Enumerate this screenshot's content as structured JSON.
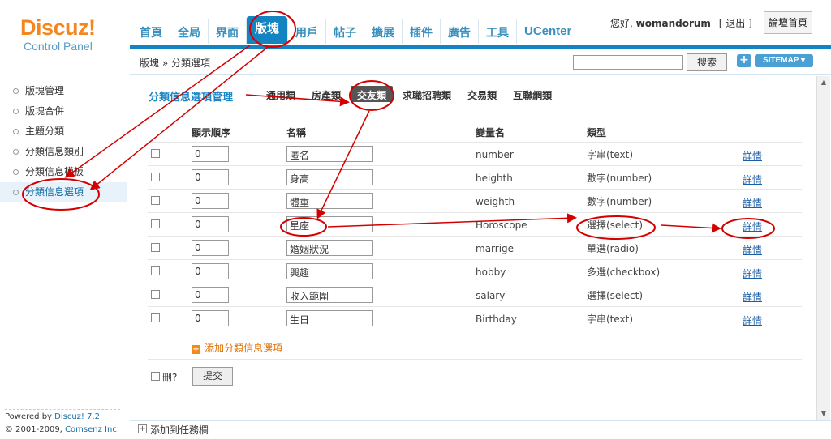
{
  "logo": {
    "brand": "Discuz!",
    "sub": "Control Panel"
  },
  "topnav": {
    "tabs": [
      "首頁",
      "全局",
      "界面",
      "版塊",
      "用戶",
      "帖子",
      "擴展",
      "插件",
      "廣告",
      "工具",
      "UCenter"
    ],
    "active_index": 3
  },
  "userbar": {
    "greeting": "您好,",
    "username": "womandorum",
    "logout": "[ 退出 ]",
    "forum_home": "論壇首頁"
  },
  "breadcrumb": "版塊 » 分類選項",
  "search": {
    "value": "",
    "button": "搜索",
    "plus": "+",
    "sitemap": "SITEMAP ▾"
  },
  "sidebar": {
    "items": [
      "版塊管理",
      "版塊合併",
      "主題分類",
      "分類信息類別",
      "分類信息模板",
      "分類信息選項"
    ],
    "active_index": 5
  },
  "powered": {
    "line1_prefix": "Powered by",
    "line1_link": "Discuz! 7.2",
    "line2_prefix": "© 2001-2009,",
    "line2_link": "Comsenz Inc."
  },
  "main": {
    "title": "分類信息選項管理",
    "subtabs": [
      "通用類",
      "房產類",
      "交友類",
      "求職招聘類",
      "交易類",
      "互聯網類"
    ],
    "active_subtab": 2,
    "columns": {
      "order": "顯示順序",
      "name": "名稱",
      "var": "變量名",
      "type": "類型"
    },
    "rows": [
      {
        "order": "0",
        "name": "匿名",
        "var": "number",
        "type": "字串(text)",
        "detail": "詳情"
      },
      {
        "order": "0",
        "name": "身高",
        "var": "heighth",
        "type": "數字(number)",
        "detail": "詳情"
      },
      {
        "order": "0",
        "name": "體重",
        "var": "weighth",
        "type": "數字(number)",
        "detail": "詳情"
      },
      {
        "order": "0",
        "name": "星座",
        "var": "Horoscope",
        "type": "選擇(select)",
        "detail": "詳情"
      },
      {
        "order": "0",
        "name": "婚姻狀況",
        "var": "marrige",
        "type": "單選(radio)",
        "detail": "詳情"
      },
      {
        "order": "0",
        "name": "興趣",
        "var": "hobby",
        "type": "多選(checkbox)",
        "detail": "詳情"
      },
      {
        "order": "0",
        "name": "收入範圍",
        "var": "salary",
        "type": "選擇(select)",
        "detail": "詳情"
      },
      {
        "order": "0",
        "name": "生日",
        "var": "Birthday",
        "type": "字串(text)",
        "detail": "詳情"
      }
    ],
    "add_label": "添加分類信息選項",
    "delete_label": "刪?",
    "submit": "提交"
  },
  "taskbar": {
    "label": "添加到任務欄"
  },
  "colors": {
    "accent": "#1483c2",
    "annotation": "#d40000",
    "logo_orange": "#f4861f"
  }
}
